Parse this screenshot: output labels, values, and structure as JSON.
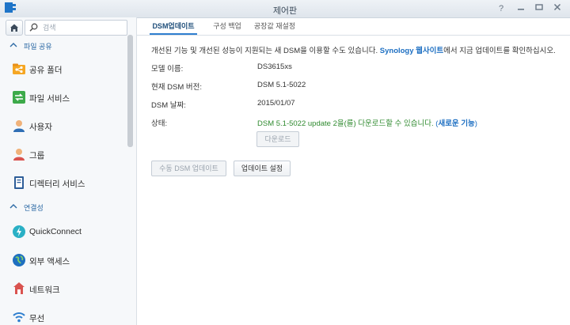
{
  "window": {
    "title": "제어판"
  },
  "sidebar": {
    "search_placeholder": "검색",
    "sections": [
      {
        "label": "파일 공유",
        "items": [
          {
            "label": "공유 폴더",
            "icon": "share-folder-icon"
          },
          {
            "label": "파일 서비스",
            "icon": "file-services-icon"
          },
          {
            "label": "사용자",
            "icon": "user-icon"
          },
          {
            "label": "그룹",
            "icon": "group-icon"
          },
          {
            "label": "디렉터리 서비스",
            "icon": "directory-service-icon"
          }
        ]
      },
      {
        "label": "연결성",
        "items": [
          {
            "label": "QuickConnect",
            "icon": "quickconnect-icon"
          },
          {
            "label": "외부 액세스",
            "icon": "external-access-icon"
          },
          {
            "label": "네트워크",
            "icon": "network-icon"
          },
          {
            "label": "무선",
            "icon": "wireless-icon"
          }
        ]
      }
    ]
  },
  "tabs": [
    "DSM업데이트",
    "구성 백업",
    "공장값 재설정"
  ],
  "main": {
    "intro_prefix": "개선된 기능 및 개선된 성능이 지원되는 새 DSM을 이용할 수도 있습니다.",
    "intro_link": "Synology 웹사이트",
    "intro_suffix": "에서 지금 업데이트를 확인하십시오.",
    "model_label": "모델 이름:",
    "model_value": "DS3615xs",
    "version_label": "현재 DSM 버전:",
    "version_value": "DSM 5.1-5022",
    "date_label": "DSM 날짜:",
    "date_value": "2015/01/07",
    "status_label": "상태:",
    "status_value": "DSM 5.1-5022 update 2을(를) 다운로드할 수 있습니다.",
    "status_link_open": "(",
    "status_link": "새로운 기능",
    "status_link_close": ")",
    "download_button": "다운로드",
    "manual_update_button": "수동 DSM 업데이트",
    "update_settings_button": "업데이트 설정"
  },
  "colors": {
    "accent": "#2f7fcf",
    "link": "#1d6fc2",
    "status_ok": "#2f8a2f"
  }
}
